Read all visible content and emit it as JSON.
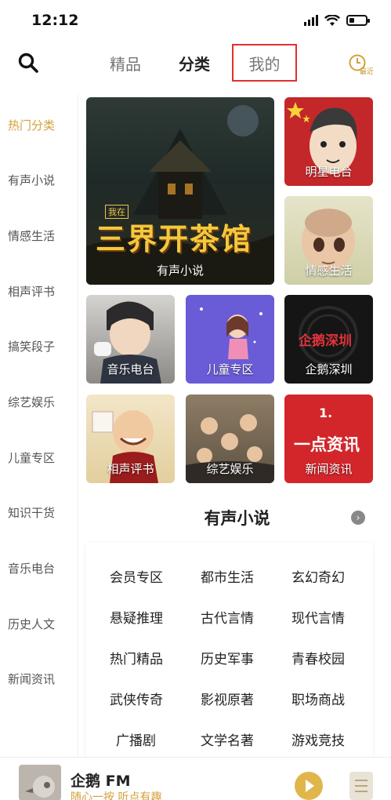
{
  "status_bar": {
    "time": "12:12"
  },
  "top_nav": {
    "tabs": [
      {
        "label": "精品"
      },
      {
        "label": "分类"
      },
      {
        "label": "我的"
      }
    ],
    "recent_label": "最近"
  },
  "sidebar": {
    "items": [
      {
        "label": "热门分类",
        "active": true
      },
      {
        "label": "有声小说"
      },
      {
        "label": "情感生活"
      },
      {
        "label": "相声评书"
      },
      {
        "label": "搞笑段子"
      },
      {
        "label": "综艺娱乐"
      },
      {
        "label": "儿童专区"
      },
      {
        "label": "知识干货"
      },
      {
        "label": "音乐电台"
      },
      {
        "label": "历史人文"
      },
      {
        "label": "新闻资讯"
      }
    ]
  },
  "tiles": {
    "big": {
      "label": "有声小说",
      "poster_title": "三界开茶馆",
      "poster_tag": "我在"
    },
    "items": [
      {
        "label": "明星电台"
      },
      {
        "label": "情感生活"
      },
      {
        "label": "音乐电台"
      },
      {
        "label": "儿童专区"
      },
      {
        "label": "企鹅深圳",
        "logo_text": "企鹅深圳"
      },
      {
        "label": "相声评书"
      },
      {
        "label": "综艺娱乐"
      },
      {
        "label": "新闻资讯",
        "logo_text": "一点资讯",
        "logo_num": "1."
      }
    ]
  },
  "section": {
    "title": "有声小说",
    "categories": [
      [
        "会员专区",
        "都市生活",
        "玄幻奇幻"
      ],
      [
        "悬疑推理",
        "古代言情",
        "现代言情"
      ],
      [
        "热门精品",
        "历史军事",
        "青春校园"
      ],
      [
        "武侠传奇",
        "影视原著",
        "职场商战"
      ],
      [
        "广播剧",
        "文学名著",
        "游戏竞技"
      ]
    ]
  },
  "player": {
    "title": "企鹅 FM",
    "subtitle": "随心一按 听点有趣"
  },
  "colors": {
    "accent": "#d4a03a",
    "highlight_box": "#e03030",
    "play_button": "#e0b64b"
  }
}
